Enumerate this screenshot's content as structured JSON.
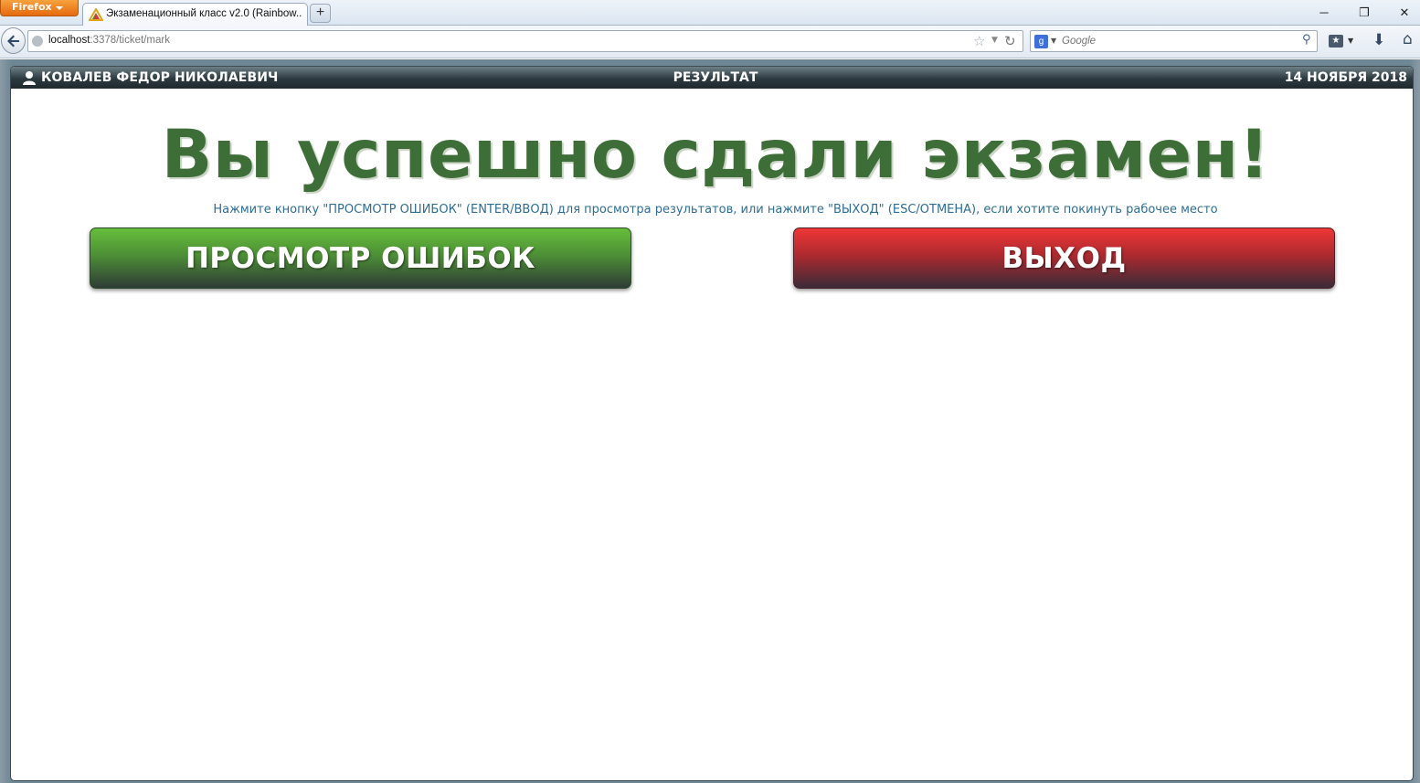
{
  "browser": {
    "menu_button": "Firefox",
    "tab_title": "Экзаменационный класс v2.0 (Rainbow...",
    "new_tab": "+",
    "url_host": "localhost",
    "url_rest": ":3378/ticket/mark",
    "search_placeholder": "Google",
    "window_controls": {
      "minimize": "─",
      "restore": "❐",
      "close": "✕"
    }
  },
  "header": {
    "user_name": "КОВАЛЕВ ФЕДОР НИКОЛАЕВИЧ",
    "title": "РЕЗУЛЬТАТ",
    "date": "14 НОЯБРЯ 2018"
  },
  "main": {
    "heading": "Вы успешно сдали экзамен!",
    "instruction": "Нажмите кнопку \"ПРОСМОТР ОШИБОК\" (ENTER/ВВОД) для просмотра результатов, или нажмите \"ВЫХОД\" (ESC/ОТМЕНА), если хотите покинуть рабочее место",
    "review_button": "ПРОСМОТР ОШИБОК",
    "exit_button": "ВЫХОД"
  },
  "colors": {
    "heading": "#3e6e38",
    "instruction": "#2d6d95",
    "review_button": "#4d8f36",
    "exit_button": "#ad2a2f",
    "header_bar": "#2c3a40"
  },
  "icons": [
    "firefox-menu-arrow-icon",
    "favicon-icon",
    "back-arrow-icon",
    "globe-icon",
    "bookmark-star-icon",
    "reload-icon",
    "google-icon",
    "search-icon",
    "bookmarks-icon",
    "downloads-icon",
    "home-icon",
    "user-icon"
  ]
}
